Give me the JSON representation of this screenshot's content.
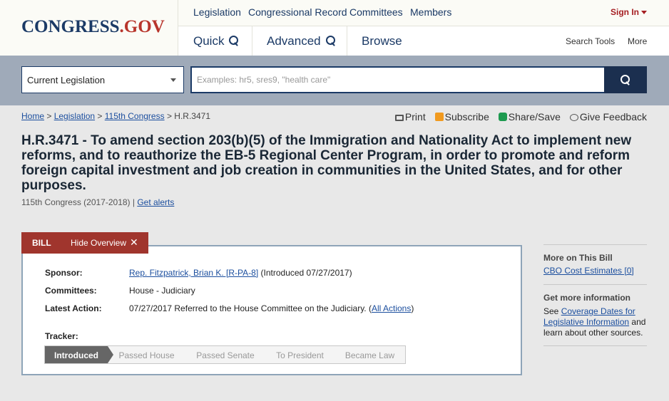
{
  "logo": {
    "part1": "CONGRESS",
    "part2": ".GOV"
  },
  "topnav": {
    "legislation": "Legislation",
    "record": "Congressional Record",
    "committees": "Committees",
    "members": "Members",
    "signin": "Sign In"
  },
  "subnav": {
    "quick": "Quick",
    "advanced": "Advanced",
    "browse": "Browse",
    "search_tools": "Search Tools",
    "more": "More"
  },
  "search": {
    "scope": "Current Legislation",
    "placeholder": "Examples: hr5, sres9, \"health care\""
  },
  "breadcrumb": {
    "home": "Home",
    "legislation": "Legislation",
    "congress": "115th Congress",
    "current": "H.R.3471",
    "sep": " > "
  },
  "tools": {
    "print": "Print",
    "subscribe": "Subscribe",
    "share": "Share/Save",
    "feedback": "Give Feedback"
  },
  "bill": {
    "title": "H.R.3471 - To amend section 203(b)(5) of the Immigration and Nationality Act to implement new reforms, and to reauthorize the EB-5 Regional Center Program, in order to promote and reform foreign capital investment and job creation in communities in the United States, and for other purposes.",
    "congress": "115th Congress (2017-2018) | ",
    "alerts": "Get alerts"
  },
  "overview": {
    "tab_bill": "BILL",
    "tab_hide": "Hide Overview",
    "sponsor_label": "Sponsor:",
    "sponsor_link": "Rep. Fitzpatrick, Brian K. [R-PA-8]",
    "sponsor_intro": " (Introduced 07/27/2017)",
    "committees_label": "Committees:",
    "committees_value": "House - Judiciary",
    "action_label": "Latest Action:",
    "action_value": "07/27/2017 Referred to the House Committee on the Judiciary.  (",
    "action_link": "All Actions",
    "action_close": ")",
    "tracker_label": "Tracker:",
    "tracker": [
      "Introduced",
      "Passed House",
      "Passed Senate",
      "To President",
      "Became Law"
    ]
  },
  "side": {
    "more_head": "More on This Bill",
    "cbo": "CBO Cost Estimates [0]",
    "info_head": "Get more information",
    "see": "See ",
    "coverage": "Coverage Dates for Legislative Information",
    "rest": " and learn about other sources."
  },
  "colors": {
    "accent": "#a0352d",
    "navy": "#1b3a66",
    "band": "#9faab9"
  }
}
